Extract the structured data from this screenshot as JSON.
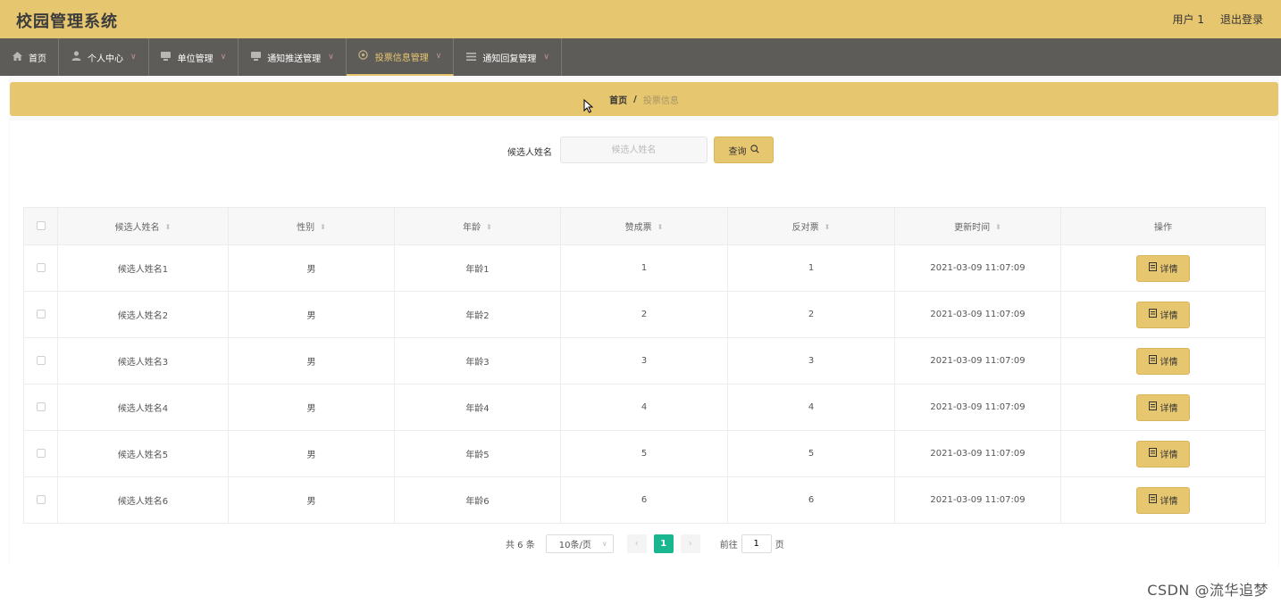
{
  "header": {
    "title": "校园管理系统",
    "user": "用户 1",
    "logout": "退出登录"
  },
  "nav": [
    {
      "label": "首页",
      "icon": "home-icon",
      "has_menu": false,
      "active": false
    },
    {
      "label": "个人中心",
      "icon": "user-icon",
      "has_menu": true,
      "active": false
    },
    {
      "label": "单位管理",
      "icon": "monitor-icon",
      "has_menu": true,
      "active": false
    },
    {
      "label": "通知推送管理",
      "icon": "monitor-icon",
      "has_menu": true,
      "active": false
    },
    {
      "label": "投票信息管理",
      "icon": "settings-icon",
      "has_menu": true,
      "active": true
    },
    {
      "label": "通知回复管理",
      "icon": "menu-icon",
      "has_menu": true,
      "active": false
    }
  ],
  "breadcrumb": {
    "home": "首页",
    "separator": "/",
    "current": "投票信息"
  },
  "search": {
    "label": "候选人姓名",
    "placeholder": "候选人姓名",
    "value": "",
    "button": "查询"
  },
  "table": {
    "headers": [
      "候选人姓名",
      "性别",
      "年龄",
      "赞成票",
      "反对票",
      "更新时间",
      "操作"
    ],
    "rows": [
      {
        "name": "候选人姓名1",
        "gender": "男",
        "age": "年龄1",
        "yes": "1",
        "no": "1",
        "time": "2021-03-09 11:07:09",
        "action": "详情"
      },
      {
        "name": "候选人姓名2",
        "gender": "男",
        "age": "年龄2",
        "yes": "2",
        "no": "2",
        "time": "2021-03-09 11:07:09",
        "action": "详情"
      },
      {
        "name": "候选人姓名3",
        "gender": "男",
        "age": "年龄3",
        "yes": "3",
        "no": "3",
        "time": "2021-03-09 11:07:09",
        "action": "详情"
      },
      {
        "name": "候选人姓名4",
        "gender": "男",
        "age": "年龄4",
        "yes": "4",
        "no": "4",
        "time": "2021-03-09 11:07:09",
        "action": "详情"
      },
      {
        "name": "候选人姓名5",
        "gender": "男",
        "age": "年龄5",
        "yes": "5",
        "no": "5",
        "time": "2021-03-09 11:07:09",
        "action": "详情"
      },
      {
        "name": "候选人姓名6",
        "gender": "男",
        "age": "年龄6",
        "yes": "6",
        "no": "6",
        "time": "2021-03-09 11:07:09",
        "action": "详情"
      }
    ]
  },
  "pagination": {
    "total": "共 6 条",
    "page_size": "10条/页",
    "current_page": "1",
    "goto_label": "前往",
    "goto_value": "1",
    "goto_suffix": "页"
  },
  "watermark": "CSDN @流华追梦",
  "colors": {
    "accent": "#e7c670",
    "nav_bg": "#5e5c59",
    "page_active": "#19b68f"
  }
}
